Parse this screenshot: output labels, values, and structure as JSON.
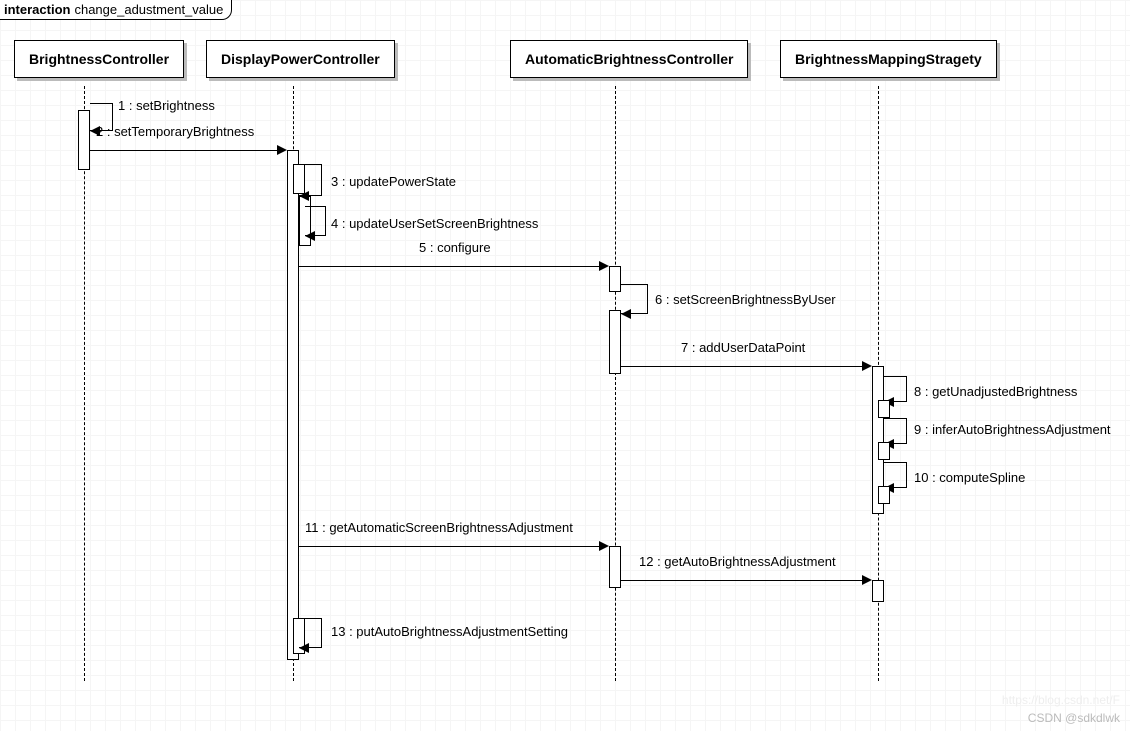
{
  "diagram": {
    "kind_label": "interaction",
    "name": "change_adustment_value"
  },
  "participants": {
    "p1": "BrightnessController",
    "p2": "DisplayPowerController",
    "p3": "AutomaticBrightnessController",
    "p4": "BrightnessMappingStragety"
  },
  "messages": {
    "m1": "1 : setBrightness",
    "m2": "2 : setTemporaryBrightness",
    "m3": "3 : updatePowerState",
    "m4": "4 : updateUserSetScreenBrightness",
    "m5": "5 : configure",
    "m6": "6 : setScreenBrightnessByUser",
    "m7": "7 : addUserDataPoint",
    "m8": "8 : getUnadjustedBrightness",
    "m9": "9 : inferAutoBrightnessAdjustment",
    "m10": "10 : computeSpline",
    "m11": "11 : getAutomaticScreenBrightnessAdjustment",
    "m12": "12 : getAutoBrightnessAdjustment",
    "m13": "13 : putAutoBrightnessAdjustmentSetting"
  },
  "watermark": {
    "line1": "https://blog.csdn.net/F",
    "line2": "CSDN @sdkdlwk"
  },
  "chart_data": {
    "type": "uml_sequence_diagram",
    "interaction_name": "change_adustment_value",
    "participants": [
      "BrightnessController",
      "DisplayPowerController",
      "AutomaticBrightnessController",
      "BrightnessMappingStragety"
    ],
    "messages": [
      {
        "seq": 1,
        "from": "BrightnessController",
        "to": "BrightnessController",
        "label": "setBrightness",
        "self": true
      },
      {
        "seq": 2,
        "from": "BrightnessController",
        "to": "DisplayPowerController",
        "label": "setTemporaryBrightness"
      },
      {
        "seq": 3,
        "from": "DisplayPowerController",
        "to": "DisplayPowerController",
        "label": "updatePowerState",
        "self": true
      },
      {
        "seq": 4,
        "from": "DisplayPowerController",
        "to": "DisplayPowerController",
        "label": "updateUserSetScreenBrightness",
        "self": true
      },
      {
        "seq": 5,
        "from": "DisplayPowerController",
        "to": "AutomaticBrightnessController",
        "label": "configure"
      },
      {
        "seq": 6,
        "from": "AutomaticBrightnessController",
        "to": "AutomaticBrightnessController",
        "label": "setScreenBrightnessByUser",
        "self": true
      },
      {
        "seq": 7,
        "from": "AutomaticBrightnessController",
        "to": "BrightnessMappingStragety",
        "label": "addUserDataPoint"
      },
      {
        "seq": 8,
        "from": "BrightnessMappingStragety",
        "to": "BrightnessMappingStragety",
        "label": "getUnadjustedBrightness",
        "self": true
      },
      {
        "seq": 9,
        "from": "BrightnessMappingStragety",
        "to": "BrightnessMappingStragety",
        "label": "inferAutoBrightnessAdjustment",
        "self": true
      },
      {
        "seq": 10,
        "from": "BrightnessMappingStragety",
        "to": "BrightnessMappingStragety",
        "label": "computeSpline",
        "self": true
      },
      {
        "seq": 11,
        "from": "DisplayPowerController",
        "to": "AutomaticBrightnessController",
        "label": "getAutomaticScreenBrightnessAdjustment"
      },
      {
        "seq": 12,
        "from": "AutomaticBrightnessController",
        "to": "BrightnessMappingStragety",
        "label": "getAutoBrightnessAdjustment"
      },
      {
        "seq": 13,
        "from": "DisplayPowerController",
        "to": "DisplayPowerController",
        "label": "putAutoBrightnessAdjustmentSetting",
        "self": true
      }
    ]
  }
}
